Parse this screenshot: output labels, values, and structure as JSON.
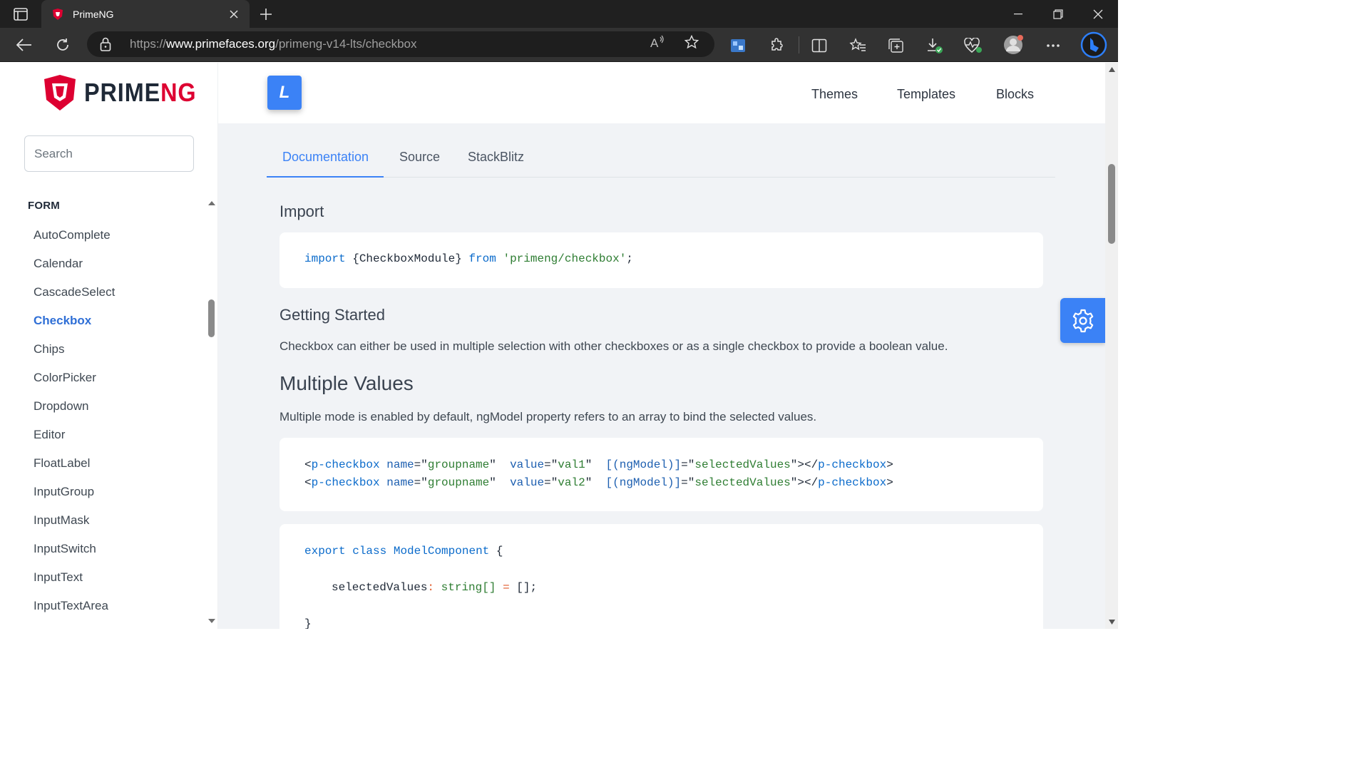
{
  "browser": {
    "tab_title": "PrimeNG",
    "url_prefix": "https://",
    "url_host": "www.primefaces.org",
    "url_path": "/primeng-v14-lts/checkbox"
  },
  "logo": {
    "text_prime": "PRIME",
    "text_ng": "NG"
  },
  "search": {
    "placeholder": "Search"
  },
  "menu": {
    "section": "FORM",
    "items": [
      "AutoComplete",
      "Calendar",
      "CascadeSelect",
      "Checkbox",
      "Chips",
      "ColorPicker",
      "Dropdown",
      "Editor",
      "FloatLabel",
      "InputGroup",
      "InputMask",
      "InputSwitch",
      "InputText",
      "InputTextArea"
    ],
    "active": "Checkbox"
  },
  "topbar": {
    "version_letter": "L",
    "nav": [
      "Themes",
      "Templates",
      "Blocks"
    ]
  },
  "tabs": [
    "Documentation",
    "Source",
    "StackBlitz"
  ],
  "content": {
    "import_heading": "Import",
    "import_code": {
      "kw_import": "import",
      "braces": "{CheckboxModule}",
      "kw_from": "from",
      "module": "'primeng/checkbox'",
      "end": ";"
    },
    "getting_started_heading": "Getting Started",
    "getting_started_text": "Checkbox can either be used in multiple selection with other checkboxes or as a single checkbox to provide a boolean value.",
    "multiple_heading": "Multiple Values",
    "multiple_text": "Multiple mode is enabled by default, ngModel property refers to an array to bind the selected values.",
    "template_lines": [
      {
        "value": "val1"
      },
      {
        "value": "val2"
      }
    ],
    "template_parts": {
      "tag": "p-checkbox",
      "attr_name": "name",
      "name_val": "groupname",
      "attr_value": "value",
      "attr_model": "[(ngModel)]",
      "model_val": "selectedValues"
    },
    "ts_code": {
      "kw_export": "export",
      "kw_class": "class",
      "class_name": "ModelComponent",
      "open": "{",
      "prop": "selectedValues",
      "colon": ":",
      "type": "string[]",
      "eq": "=",
      "init": "[];",
      "close": "}"
    }
  },
  "colors": {
    "accent": "#3b82f6",
    "brand_red": "#dd0031"
  },
  "icons": [
    "gear-icon",
    "lock-icon",
    "back-icon",
    "refresh-icon",
    "star-icon",
    "more-icon"
  ]
}
